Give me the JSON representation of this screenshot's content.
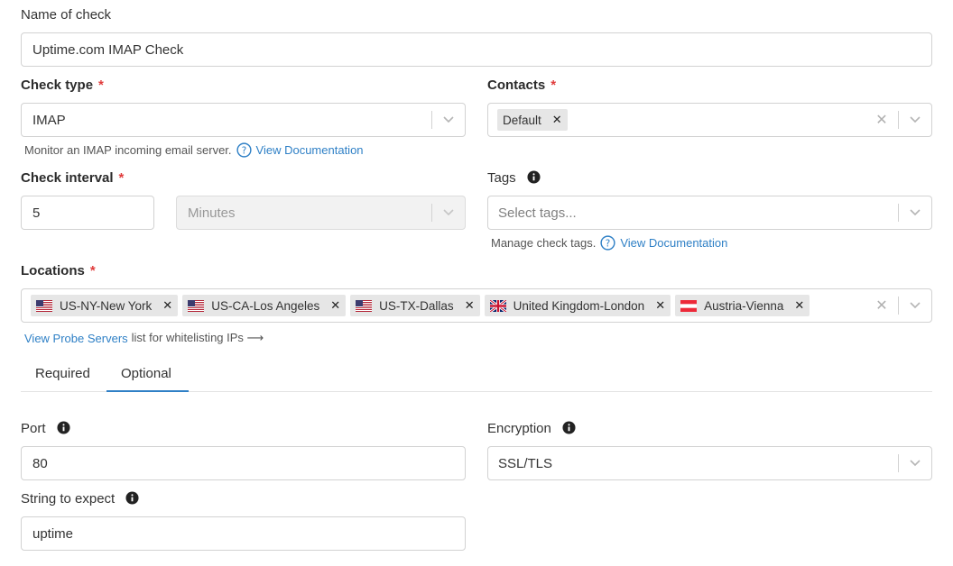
{
  "name_of_check": {
    "label": "Name of check",
    "value": "Uptime.com IMAP Check"
  },
  "check_type": {
    "label": "Check type",
    "required_mark": "*",
    "value": "IMAP",
    "hint": "Monitor an IMAP incoming email server.",
    "doc_link": "View Documentation"
  },
  "contacts": {
    "label": "Contacts",
    "required_mark": "*",
    "chips": [
      "Default"
    ]
  },
  "check_interval": {
    "label": "Check interval",
    "required_mark": "*",
    "value": "5",
    "unit": "Minutes"
  },
  "tags": {
    "label": "Tags",
    "placeholder": "Select tags...",
    "hint": "Manage check tags.",
    "doc_link": "View Documentation"
  },
  "locations": {
    "label": "Locations",
    "required_mark": "*",
    "chips": [
      {
        "name": "US-NY-New York",
        "flag": "us-flag-icon"
      },
      {
        "name": "US-CA-Los Angeles",
        "flag": "us-flag-icon"
      },
      {
        "name": "US-TX-Dallas",
        "flag": "us-flag-icon"
      },
      {
        "name": "United Kingdom-London",
        "flag": "uk-flag-icon"
      },
      {
        "name": "Austria-Vienna",
        "flag": "austria-flag-icon"
      }
    ],
    "probe_link": "View Probe Servers",
    "probe_suffix": "list for whitelisting IPs ⟶"
  },
  "tabs": [
    {
      "label": "Required",
      "active": false
    },
    {
      "label": "Optional",
      "active": true
    }
  ],
  "port": {
    "label": "Port",
    "value": "80"
  },
  "encryption": {
    "label": "Encryption",
    "value": "SSL/TLS"
  },
  "string_to_expect": {
    "label": "String to expect",
    "value": "uptime"
  },
  "colors": {
    "accent": "#2f80c6",
    "required": "#e03c3c",
    "chip_bg": "#e6e6e6",
    "border": "#d2d2d2"
  }
}
